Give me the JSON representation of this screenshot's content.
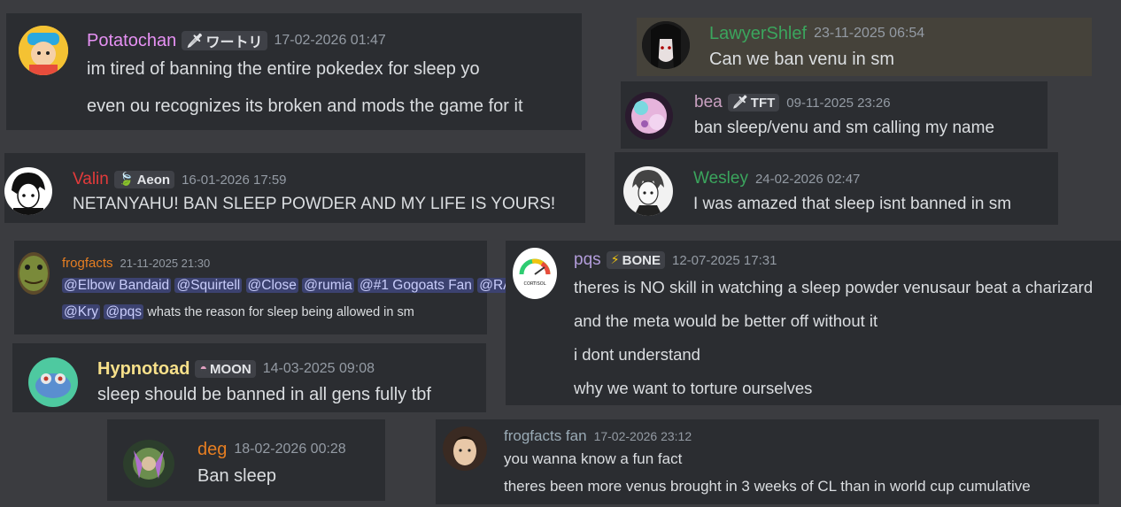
{
  "messages": [
    {
      "id": "potatochan",
      "username": "Potatochan",
      "name_color": "#e691f3",
      "tag": "ワートリ",
      "tag_icon": "sword-icon",
      "timestamp": "17-02-2026 01:47",
      "lines": [
        "im tired of banning the entire pokedex for sleep yo",
        "even ou recognizes its broken and mods the game for it"
      ]
    },
    {
      "id": "lawyershlef",
      "username": "LawyerShlef",
      "name_color": "#3ba55d",
      "tag": "",
      "timestamp": "23-11-2025 06:54",
      "lines": [
        "Can we ban venu in sm"
      ]
    },
    {
      "id": "bea",
      "username": "bea",
      "name_color": "#c8a0c0",
      "tag": "TFT",
      "tag_icon": "sword-icon",
      "timestamp": "09-11-2025 23:26",
      "lines": [
        "ban sleep/venu and sm calling my name"
      ]
    },
    {
      "id": "valin",
      "username": "Valin",
      "name_color": "#e33b3b",
      "tag": "Aeon",
      "tag_icon": "leaf-icon",
      "timestamp": "16-01-2026 17:59",
      "lines": [
        "NETANYAHU! BAN SLEEP POWDER AND MY LIFE IS YOURS!"
      ]
    },
    {
      "id": "wesley",
      "username": "Wesley",
      "name_color": "#3ba55d",
      "tag": "",
      "timestamp": "24-02-2026 02:47",
      "lines": [
        "I was amazed that sleep isnt banned in sm"
      ]
    },
    {
      "id": "frogfacts",
      "username": "frogfacts",
      "name_color": "#e67e22",
      "tag": "",
      "timestamp": "21-11-2025 21:30",
      "mentions_row1": [
        "@Elbow Bandaid",
        "@Squirtell",
        "@Close",
        "@rumia",
        "@#1 Gogoats Fan",
        "@RADU"
      ],
      "mentions_row2": [
        "@Kry",
        "@pqs"
      ],
      "row2_text": "whats the reason for sleep being allowed in sm"
    },
    {
      "id": "pqs",
      "username": "pqs",
      "name_color": "#b39ddb",
      "tag": "BONE",
      "tag_icon": "lightning-icon",
      "timestamp": "12-07-2025 17:31",
      "avatar_label": "CORTISOL",
      "lines": [
        "theres is NO skill in watching a sleep powder venusaur beat a charizard",
        "and the meta would be better off without it",
        "i dont understand",
        "why we want to torture ourselves"
      ]
    },
    {
      "id": "hypnotoad",
      "username": "Hypnotoad",
      "name_color": "#f7e08a",
      "tag": "MOON",
      "tag_icon": "moon-ball-icon",
      "timestamp": "14-03-2025 09:08",
      "lines": [
        "sleep should be banned in all gens fully tbf"
      ]
    },
    {
      "id": "deg",
      "username": "deg",
      "name_color": "#e67e22",
      "tag": "",
      "timestamp": "18-02-2026 00:28",
      "lines": [
        "Ban sleep"
      ]
    },
    {
      "id": "frogfactsfan",
      "username": "frogfacts fan",
      "name_color": "#99aab5",
      "tag": "",
      "timestamp": "17-02-2026 23:12",
      "lines": [
        "you wanna know a fun fact",
        "theres been more venus brought in 3 weeks of CL than in world cup cumulative"
      ]
    }
  ]
}
